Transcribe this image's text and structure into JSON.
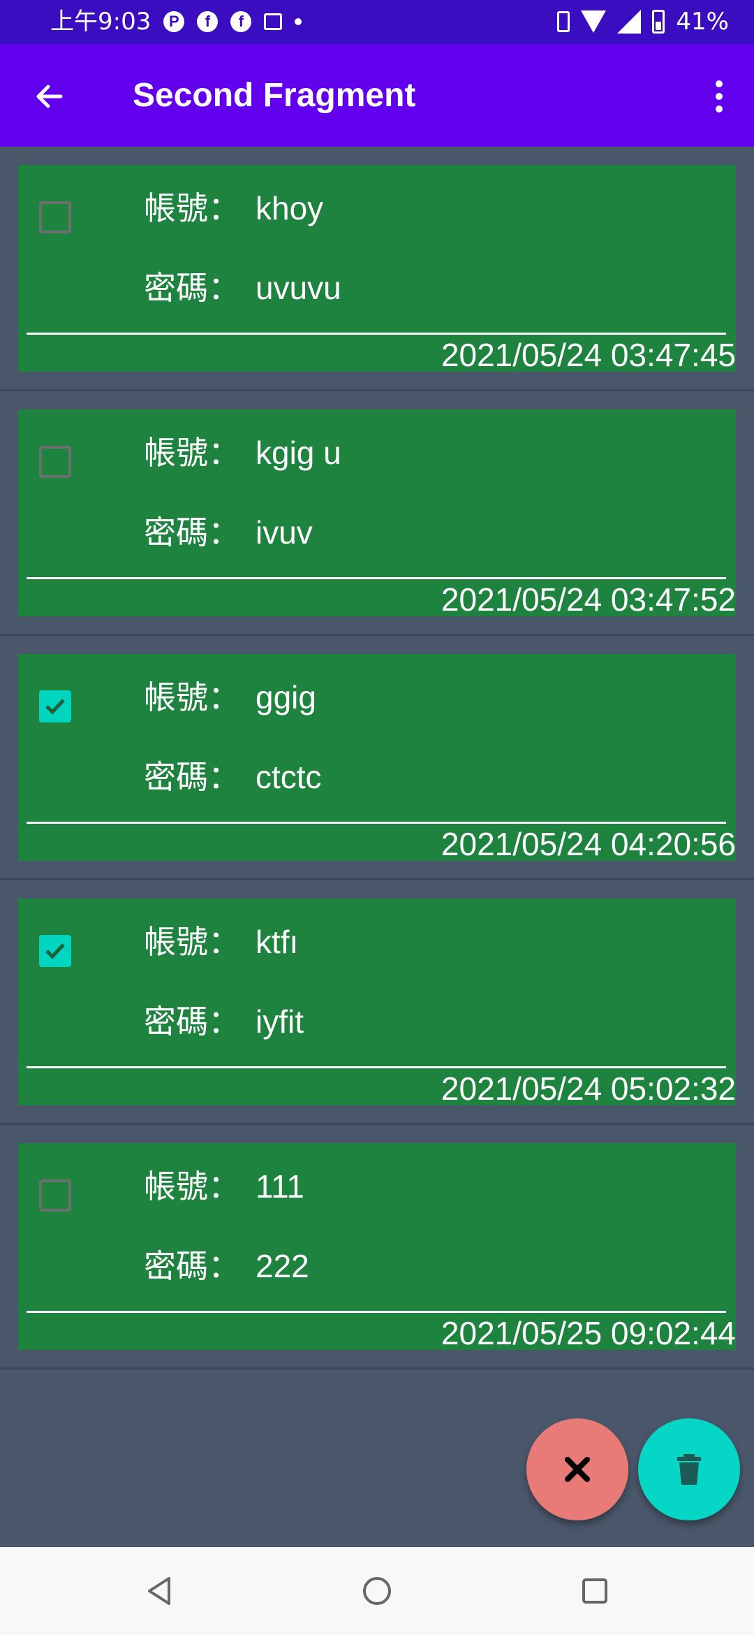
{
  "status_bar": {
    "time": "上午9:03",
    "notification_icons": [
      "p-icon",
      "facebook-icon",
      "facebook-icon",
      "image-icon",
      "dot-icon"
    ],
    "battery_percent": "41%"
  },
  "app_bar": {
    "title": "Second Fragment"
  },
  "labels": {
    "account": "帳號：",
    "password": "密碼："
  },
  "items": [
    {
      "account": "khoy",
      "password": "uvuvu",
      "timestamp": "2021/05/24 03:47:45",
      "checked": false
    },
    {
      "account": "kgig u",
      "password": "ivuv",
      "timestamp": "2021/05/24 03:47:52",
      "checked": false
    },
    {
      "account": "ggig",
      "password": "ctctc",
      "timestamp": "2021/05/24 04:20:56",
      "checked": true
    },
    {
      "account": "ktfı",
      "password": "iyfit",
      "timestamp": "2021/05/24 05:02:32",
      "checked": true
    },
    {
      "account": "111",
      "password": "222",
      "timestamp": "2021/05/25 09:02:44",
      "checked": false
    }
  ],
  "fabs": {
    "cancel_icon": "close-icon",
    "delete_icon": "trash-icon"
  },
  "colors": {
    "status_bar": "#3a0ec0",
    "app_bar": "#6200ee",
    "background": "#4a576a",
    "card": "#1f8340",
    "checkbox_checked": "#00d5c0",
    "fab_cancel": "#e87a77",
    "fab_delete": "#06d6c6"
  }
}
